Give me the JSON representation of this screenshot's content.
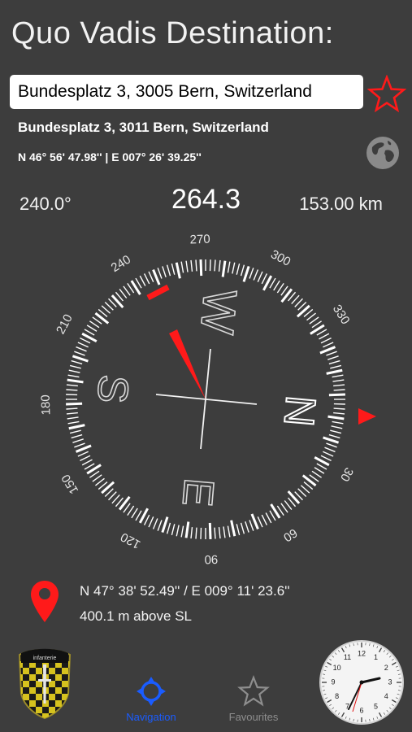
{
  "header": {
    "title": "Quo Vadis Destination:"
  },
  "destination": {
    "input_value": "Bundesplatz 3, 3005 Bern, Switzerland",
    "resolved_address": "Bundesplatz 3, 3011 Bern, Switzerland",
    "coordinates": "N 46° 56' 47.98'' | E 007° 26' 39.25''"
  },
  "readouts": {
    "bearing": "240.0°",
    "heading": "264.3",
    "distance": "153.00 km"
  },
  "compass": {
    "ring_labels": [
      "270",
      "300",
      "330",
      "30",
      "60",
      "90",
      "120",
      "150",
      "180",
      "210",
      "240"
    ],
    "cardinals": [
      "N",
      "E",
      "S",
      "W"
    ],
    "accent_color": "#ff1a1a"
  },
  "location": {
    "coordinates": "N 47° 38' 52.49'' / E 009° 11' 23.6''",
    "altitude": "400.1  m above SL"
  },
  "badge": {
    "text": "infanterie"
  },
  "clock": {
    "numbers": [
      "12",
      "1",
      "2",
      "3",
      "4",
      "5",
      "6",
      "7",
      "8",
      "9",
      "10",
      "11"
    ]
  },
  "tabs": [
    {
      "label": "Navigation",
      "icon": "crosshair-icon",
      "active": true,
      "color": "#1a5cff"
    },
    {
      "label": "Favourites",
      "icon": "star-icon",
      "active": false,
      "color": "#8e8e8e"
    }
  ]
}
